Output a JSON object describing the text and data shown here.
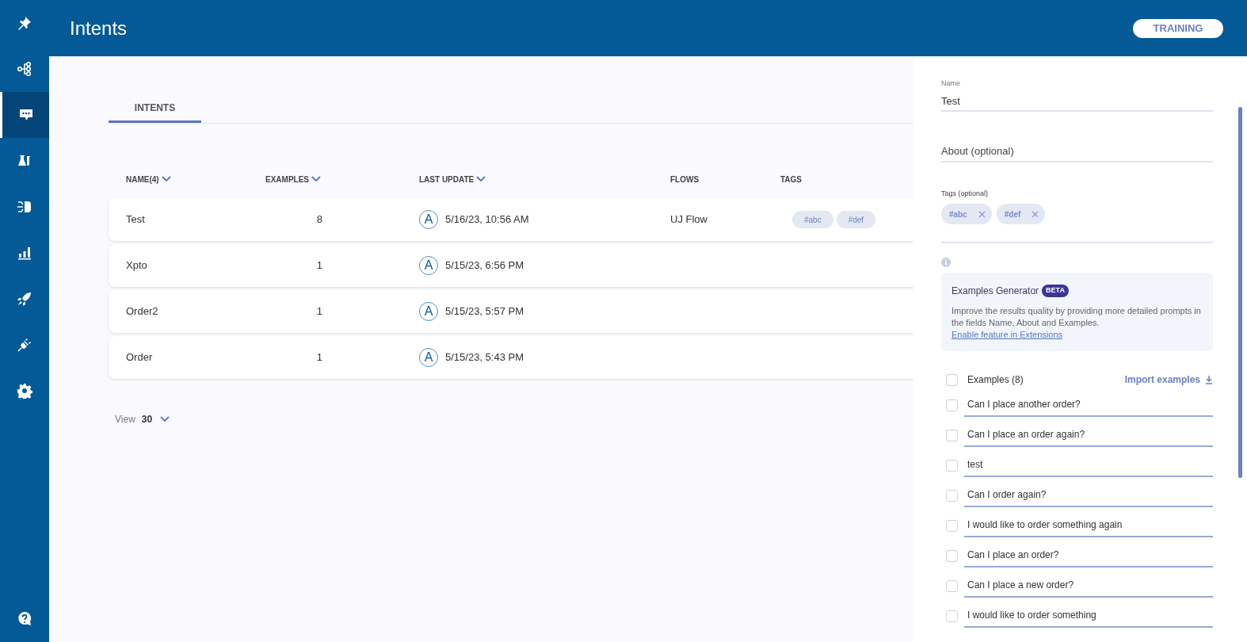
{
  "sidebar": {
    "items": [
      {
        "kind": "pin",
        "selected": false
      },
      {
        "kind": "flow",
        "selected": false
      },
      {
        "kind": "chat",
        "selected": true
      },
      {
        "kind": "lab",
        "selected": false
      },
      {
        "kind": "brain",
        "selected": false
      },
      {
        "kind": "chart",
        "selected": false
      },
      {
        "kind": "rocket",
        "selected": false
      },
      {
        "kind": "plug",
        "selected": false
      },
      {
        "kind": "gear",
        "selected": false
      }
    ],
    "help": {
      "kind": "help"
    }
  },
  "header": {
    "title": "Intents",
    "button": "TRAINING"
  },
  "tabs": [
    {
      "label": "INTENTS",
      "selected": true
    }
  ],
  "table": {
    "columns": [
      {
        "label": "NAME(4)",
        "sortable": true
      },
      {
        "label": "EXAMPLES",
        "sortable": true
      },
      {
        "label": "LAST UPDATE",
        "sortable": true
      },
      {
        "label": "FLOWS",
        "sortable": false
      },
      {
        "label": "TAGS",
        "sortable": false
      }
    ],
    "rows": [
      {
        "name": "Test",
        "examples": "8",
        "avatar": "A",
        "updated": "5/16/23, 10:56 AM",
        "flows": "UJ Flow",
        "tags": [
          "#abc",
          "#def"
        ]
      },
      {
        "name": "Xpto",
        "examples": "1",
        "avatar": "A",
        "updated": "5/15/23, 6:56 PM",
        "tags": []
      },
      {
        "name": "Order2",
        "examples": "1",
        "avatar": "A",
        "updated": "5/15/23, 5:57 PM",
        "tags": []
      },
      {
        "name": "Order",
        "examples": "1",
        "avatar": "A",
        "updated": "5/15/23, 5:43 PM",
        "tags": []
      }
    ]
  },
  "pagination": {
    "label": "View",
    "value": "30"
  },
  "panel": {
    "name_label": "Name",
    "name_value": "Test",
    "about_placeholder": "About (optional)",
    "tags_label": "Tags (optional)",
    "tags": [
      "#abc",
      "#def"
    ],
    "generator": {
      "title": "Examples Generator",
      "badge": "BETA",
      "text": "Improve the results quality by providing more detailed prompts in the fields Name, About and Examples.",
      "link": "Enable feature in Extensions"
    },
    "examples_header": {
      "label": "Examples (8)",
      "checked": false,
      "import": "Import examples"
    },
    "examples": [
      {
        "text": "Can I place another order?",
        "checked": false
      },
      {
        "text": "Can I place an order again?",
        "checked": false
      },
      {
        "text": "test",
        "checked": false
      },
      {
        "text": "Can I order again?",
        "checked": false
      },
      {
        "text": "I would like to order something again",
        "checked": false
      },
      {
        "text": "Can I place an order?",
        "checked": false
      },
      {
        "text": "Can I place a new order?",
        "checked": false
      },
      {
        "text": "I would like to order something",
        "checked": false
      }
    ]
  }
}
